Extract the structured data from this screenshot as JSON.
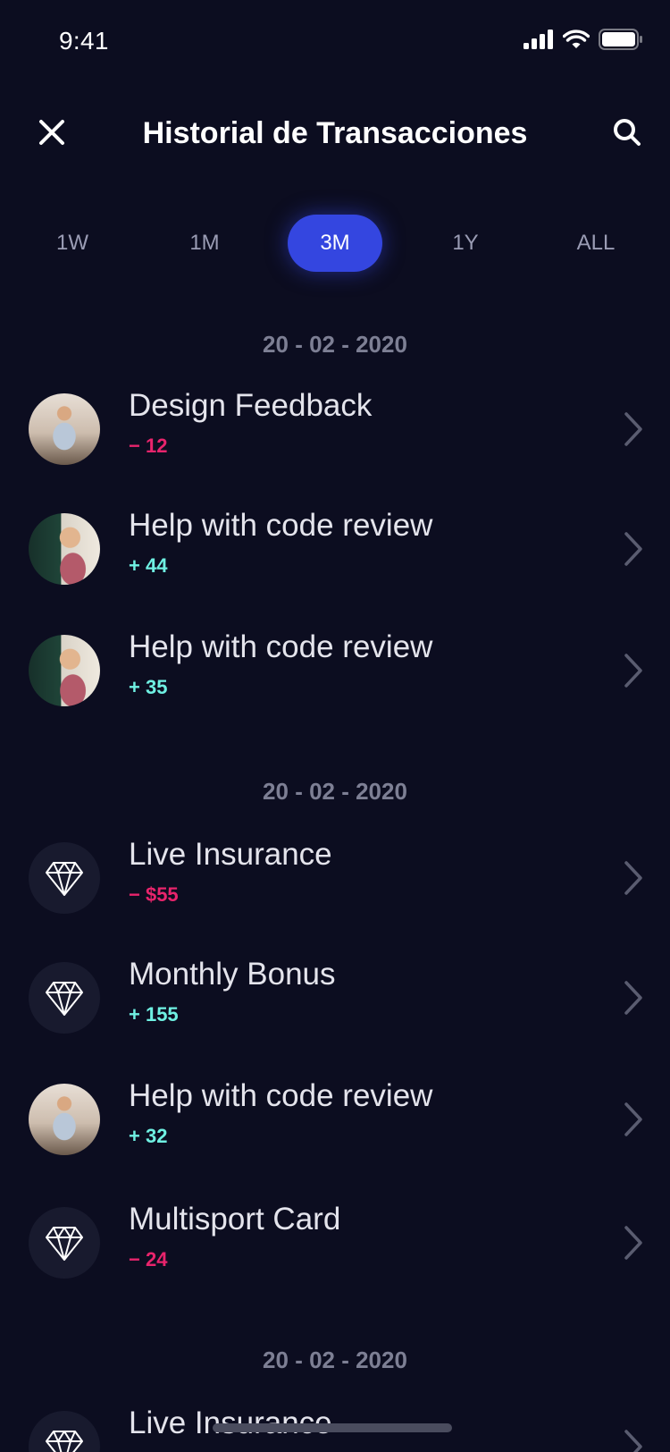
{
  "status_bar": {
    "time": "9:41",
    "icons": [
      "signal-icon",
      "wifi-icon",
      "battery-icon"
    ]
  },
  "header": {
    "title": "Historial de Transacciones",
    "close_icon": "close-icon",
    "search_icon": "search-icon"
  },
  "period_tabs": {
    "items": [
      "1W",
      "1M",
      "3M",
      "1Y",
      "ALL"
    ],
    "selected": "3M"
  },
  "colors": {
    "background": "#0c0d20",
    "accent": "#3446e0",
    "negative": "#e8246c",
    "positive": "#6ff0e2"
  },
  "groups": [
    {
      "date": "20 - 02 - 2020",
      "items": [
        {
          "title": "Design Feedback",
          "amount": "− 12",
          "type": "negative",
          "avatar": "photo-a"
        },
        {
          "title": "Help with code review",
          "amount": "+ 44",
          "type": "positive",
          "avatar": "photo-b"
        },
        {
          "title": "Help with code review",
          "amount": "+ 35",
          "type": "positive",
          "avatar": "photo-b"
        }
      ]
    },
    {
      "date": "20 - 02 - 2020",
      "items": [
        {
          "title": "Live Insurance",
          "amount": "− $55",
          "type": "negative",
          "avatar": "diamond-icon"
        },
        {
          "title": "Monthly Bonus",
          "amount": "+ 155",
          "type": "positive",
          "avatar": "diamond-icon"
        },
        {
          "title": "Help with code review",
          "amount": "+ 32",
          "type": "positive",
          "avatar": "photo-a"
        },
        {
          "title": "Multisport Card",
          "amount": "− 24",
          "type": "negative",
          "avatar": "diamond-icon"
        }
      ]
    },
    {
      "date": "20 - 02 - 2020",
      "items": [
        {
          "title": "Live Insurance",
          "amount": "",
          "type": "negative",
          "avatar": "diamond-icon"
        }
      ]
    }
  ]
}
